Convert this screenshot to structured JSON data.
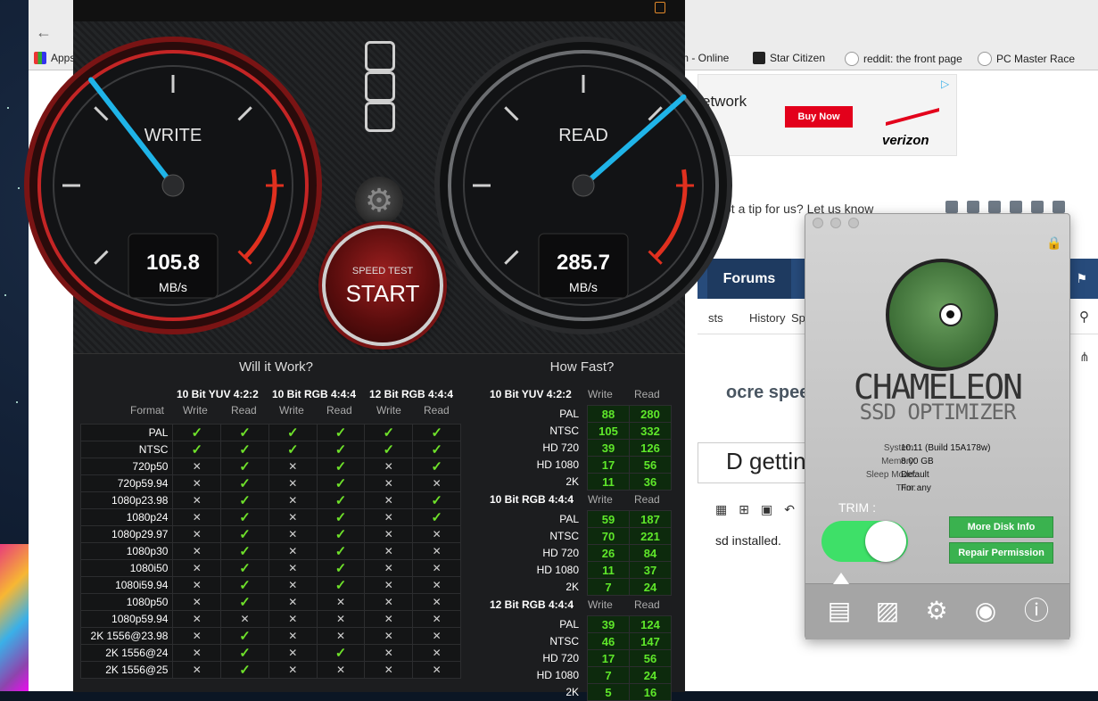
{
  "browser": {
    "bookmarks": [
      {
        "label": "Apps",
        "icon": "apps-icon"
      },
      {
        "label": "m - Online",
        "icon": "page-icon"
      },
      {
        "label": "Star Citizen",
        "icon": "star-citizen-icon"
      },
      {
        "label": "reddit: the front page",
        "icon": "reddit-icon"
      },
      {
        "label": "PC Master Race",
        "icon": "reddit-icon"
      }
    ],
    "ad": {
      "text": "etwork",
      "button": "Buy Now",
      "brand": "verizon"
    },
    "tip_text": "ot a tip for us? Let us know",
    "nav": {
      "forums": "Forums"
    },
    "subnav": [
      "sts",
      "History",
      "Sp"
    ],
    "post_title_fragment": "ocre speeds",
    "thread_title_fragment": "D getting n",
    "post_body": "sd installed."
  },
  "blackmagic": {
    "write_gauge": {
      "label": "WRITE",
      "value": "105.8",
      "unit": "MB/s",
      "needle_fraction": 0.36
    },
    "read_gauge": {
      "label": "READ",
      "value": "285.7",
      "unit": "MB/s",
      "needle_fraction": 0.68
    },
    "start": {
      "small": "SPEED TEST",
      "big": "START"
    },
    "will_it_work": {
      "title": "Will it Work?",
      "groups": [
        "10 Bit YUV 4:2:2",
        "10 Bit RGB 4:4:4",
        "12 Bit RGB 4:4:4"
      ],
      "format_label": "Format",
      "write_label": "Write",
      "read_label": "Read",
      "rows": [
        {
          "format": "PAL",
          "cells": [
            1,
            1,
            1,
            1,
            1,
            1
          ]
        },
        {
          "format": "NTSC",
          "cells": [
            1,
            1,
            1,
            1,
            1,
            1
          ]
        },
        {
          "format": "720p50",
          "cells": [
            0,
            1,
            0,
            1,
            0,
            1
          ]
        },
        {
          "format": "720p59.94",
          "cells": [
            0,
            1,
            0,
            1,
            0,
            0
          ]
        },
        {
          "format": "1080p23.98",
          "cells": [
            0,
            1,
            0,
            1,
            0,
            1
          ]
        },
        {
          "format": "1080p24",
          "cells": [
            0,
            1,
            0,
            1,
            0,
            1
          ]
        },
        {
          "format": "1080p29.97",
          "cells": [
            0,
            1,
            0,
            1,
            0,
            0
          ]
        },
        {
          "format": "1080p30",
          "cells": [
            0,
            1,
            0,
            1,
            0,
            0
          ]
        },
        {
          "format": "1080i50",
          "cells": [
            0,
            1,
            0,
            1,
            0,
            0
          ]
        },
        {
          "format": "1080i59.94",
          "cells": [
            0,
            1,
            0,
            1,
            0,
            0
          ]
        },
        {
          "format": "1080p50",
          "cells": [
            0,
            1,
            0,
            0,
            0,
            0
          ]
        },
        {
          "format": "1080p59.94",
          "cells": [
            0,
            0,
            0,
            0,
            0,
            0
          ]
        },
        {
          "format": "2K 1556@23.98",
          "cells": [
            0,
            1,
            0,
            0,
            0,
            0
          ]
        },
        {
          "format": "2K 1556@24",
          "cells": [
            0,
            1,
            0,
            1,
            0,
            0
          ]
        },
        {
          "format": "2K 1556@25",
          "cells": [
            0,
            1,
            0,
            0,
            0,
            0
          ]
        }
      ]
    },
    "how_fast": {
      "title": "How Fast?",
      "write_label": "Write",
      "read_label": "Read",
      "groups": [
        {
          "name": "10 Bit YUV 4:2:2",
          "rows": [
            {
              "format": "PAL",
              "write": "88",
              "read": "280"
            },
            {
              "format": "NTSC",
              "write": "105",
              "read": "332"
            },
            {
              "format": "HD 720",
              "write": "39",
              "read": "126"
            },
            {
              "format": "HD 1080",
              "write": "17",
              "read": "56"
            },
            {
              "format": "2K",
              "write": "11",
              "read": "36"
            }
          ]
        },
        {
          "name": "10 Bit RGB 4:4:4",
          "rows": [
            {
              "format": "PAL",
              "write": "59",
              "read": "187"
            },
            {
              "format": "NTSC",
              "write": "70",
              "read": "221"
            },
            {
              "format": "HD 720",
              "write": "26",
              "read": "84"
            },
            {
              "format": "HD 1080",
              "write": "11",
              "read": "37"
            },
            {
              "format": "2K",
              "write": "7",
              "read": "24"
            }
          ]
        },
        {
          "name": "12 Bit RGB 4:4:4",
          "rows": [
            {
              "format": "PAL",
              "write": "39",
              "read": "124"
            },
            {
              "format": "NTSC",
              "write": "46",
              "read": "147"
            },
            {
              "format": "HD 720",
              "write": "17",
              "read": "56"
            },
            {
              "format": "HD 1080",
              "write": "7",
              "read": "24"
            },
            {
              "format": "2K",
              "write": "5",
              "read": "16"
            }
          ]
        }
      ]
    }
  },
  "chameleon": {
    "name": "CHAMELEON",
    "subtitle": "SSD OPTIMIZER",
    "system_label": "System:",
    "system_value": "10.11 (Build 15A178w)",
    "memory_label": "Memory:",
    "memory_value": "8.00 GB",
    "sleep_label": "Sleep Mode:",
    "sleep_value": "Default",
    "trim_label_info": "Trim:",
    "trim_value": "For any",
    "trim_toggle_label": "TRIM :",
    "trim_on": true,
    "more_disk_info": "More Disk Info",
    "repair_permission": "Repair Permission",
    "dock_icons": [
      "disk-list-icon",
      "disk-utility-icon",
      "settings-gear-icon",
      "eye-icon",
      "info-icon"
    ]
  },
  "colors": {
    "gauge_needle": "#1fb4e8",
    "accent_red": "#c41a1a",
    "check_green": "#6ee02a",
    "speed_green": "#5fe82a",
    "cham_toggle": "#3ee068",
    "cham_button": "#3ab24f",
    "forum_nav": "#274b7b"
  }
}
